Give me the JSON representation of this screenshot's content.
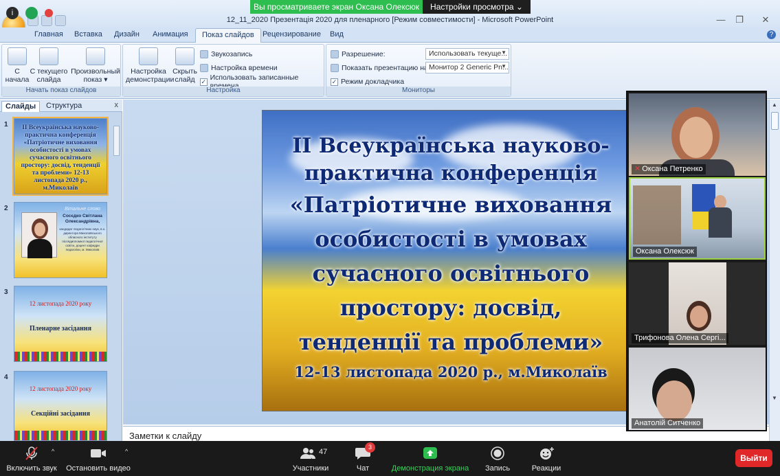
{
  "window": {
    "title": "12_11_2020 Презентація 2020 для пленарного [Режим совместимости] - Microsoft PowerPoint",
    "minimize": "—",
    "restore": "❐",
    "close": "✕"
  },
  "zoom_top": {
    "info_icon": "i",
    "share_banner": "Вы просматриваете экран Оксана Олексюк",
    "view_options": "Настройки просмотра ⌄"
  },
  "ribbon_tabs": [
    "Главная",
    "Вставка",
    "Дизайн",
    "Анимация",
    "Показ слайдов",
    "Рецензирование",
    "Вид"
  ],
  "help_icon": "?",
  "ribbon": {
    "start_group": {
      "label": "Начать показ слайдов",
      "from_start": "С\nначала",
      "from_current": "С текущего\nслайда",
      "custom_show": "Произвольный\nпоказ ▾"
    },
    "setup_group": {
      "label": "Настройка",
      "setup_show": "Настройка\nдемонстрации",
      "hide_slide": "Скрыть\nслайд",
      "record": "Звукозапись",
      "rehearse": "Настройка времени",
      "use_timings": "Использовать записанные времена"
    },
    "monitors_group": {
      "label": "Мониторы",
      "resolution_label": "Разрешение:",
      "resolution_value": "Использовать текуще...",
      "show_on_label": "Показать презентацию на:",
      "show_on_value": "Монитор 2 Generic Pn...",
      "presenter_view": "Режим докладчика"
    }
  },
  "slides_pane": {
    "tab_slides": "Слайды",
    "tab_outline": "Структура",
    "close": "x",
    "slides": [
      {
        "num": "1",
        "text": "ІІ Всеукраїнська науково-практична конференція «Патріотичне виховання особистості в умовах сучасного освітнього простору: досвід, тенденції та проблеми» 12-13 листопада 2020 р., м.Миколаїв"
      },
      {
        "num": "2",
        "head": "Вітальне слово",
        "name": "Сосєдко Світлана Олександрівна,",
        "bio": "кандидат педагогічних наук, в.о. директора Миколаївського обласного інституту післядипломної педагогічної освіти, доцент кафедри педагогіки, м. Миколаїв"
      },
      {
        "num": "3",
        "date": "12 листопада 2020 року",
        "head": "Пленарне засідання"
      },
      {
        "num": "4",
        "date": "12 листопада 2020 року",
        "head": "Секційні засідання"
      }
    ]
  },
  "slide": {
    "line1": "ІІ Всеукраїнська науково-",
    "line2": "практична конференція",
    "sub_lines": [
      "«Патріотичне виховання",
      "особистості в умовах",
      "сучасного освітнього",
      "простору: досвід,",
      "тенденції та проблеми»"
    ],
    "date": "12-13 листопада 2020 р., м.Миколаїв"
  },
  "notes_placeholder": "Заметки к слайду",
  "participants": [
    {
      "name": "Оксана Петренко",
      "muted": true
    },
    {
      "name": "Оксана Олексюк",
      "muted": false,
      "active_speaker": true
    },
    {
      "name": "Трифонова Олена Сергі...",
      "muted": false
    },
    {
      "name": "Анатолій Ситченко",
      "muted": false
    }
  ],
  "zoom_toolbar": {
    "mute": "Включить звук",
    "video": "Остановить видео",
    "participants": "Участники",
    "participants_count": "47",
    "chat": "Чат",
    "chat_badge": "3",
    "share": "Демонстрация экрана",
    "record": "Запись",
    "reactions": "Реакции",
    "leave": "Выйти"
  },
  "colors": {
    "zoom_green": "#2ebd4f",
    "zoom_red": "#e02828",
    "ribbon_blue": "#d3e2f4",
    "slide_title_blue": "#0f2a74"
  }
}
